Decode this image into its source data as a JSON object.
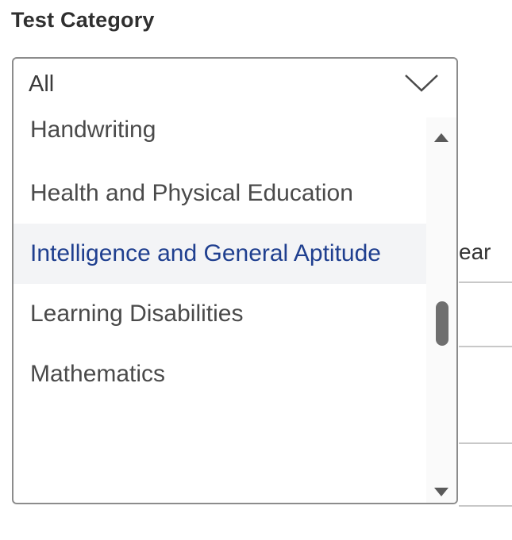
{
  "label": "Test Category",
  "select": {
    "value": "All",
    "chevron_icon": "chevron-down-icon"
  },
  "options": [
    {
      "label": "Handwriting",
      "highlighted": false
    },
    {
      "label": "Health and Physical Education",
      "highlighted": false
    },
    {
      "label": "Intelligence and General Aptitude",
      "highlighted": true
    },
    {
      "label": "Learning Disabilities",
      "highlighted": false
    },
    {
      "label": "Mathematics",
      "highlighted": false
    }
  ],
  "background": {
    "column_header_fragment": "ear"
  },
  "colors": {
    "highlight_bg": "#f3f4f6",
    "highlight_text": "#1f3f8f",
    "border": "#8c8c8c"
  }
}
